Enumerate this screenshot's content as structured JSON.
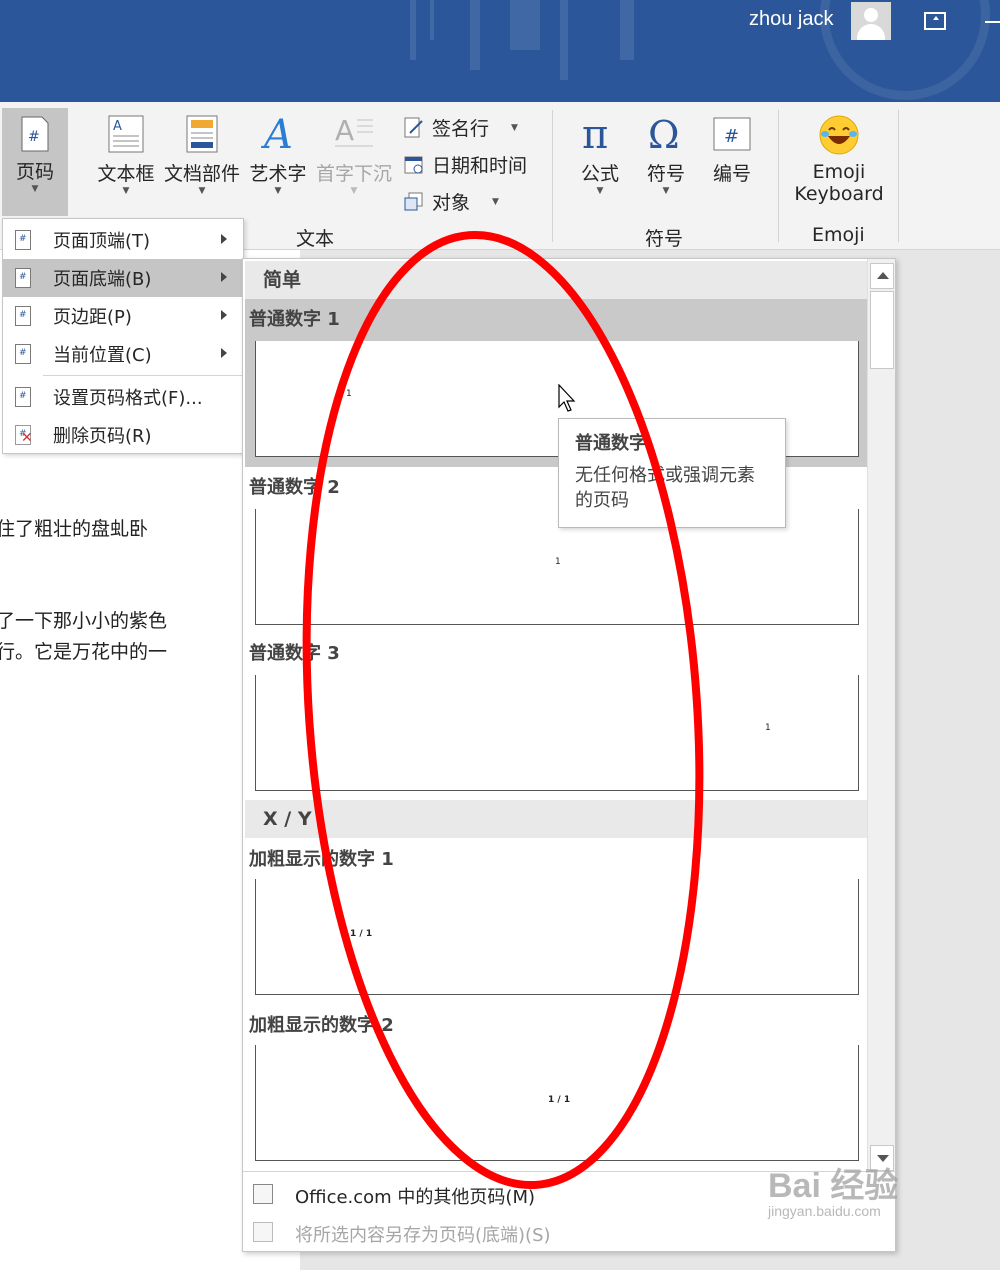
{
  "titlebar": {
    "user_name": "zhou jack",
    "accent": "#2b579a"
  },
  "ribbon": {
    "page_number": "页码",
    "textbox": "文本框",
    "quick_parts": "文档部件",
    "wordart": "艺术字",
    "dropcap": "首字下沉",
    "signature_line": "签名行",
    "date_time": "日期和时间",
    "object": "对象",
    "text_group": "文本",
    "equation": "公式",
    "symbol": "符号",
    "number": "编号",
    "symbols_group": "符号",
    "emoji_label_1": "Emoji",
    "emoji_label_2": "Keyboard",
    "emoji_group": "Emoji"
  },
  "menu": {
    "items": [
      {
        "label": "页面顶端(T)"
      },
      {
        "label": "页面底端(B)"
      },
      {
        "label": "页边距(P)"
      },
      {
        "label": "当前位置(C)"
      },
      {
        "label": "设置页码格式(F)..."
      },
      {
        "label": "删除页码(R)"
      }
    ]
  },
  "gallery": {
    "section_simple": "简单",
    "section_xy": "X / Y",
    "items": [
      {
        "title": "普通数字 1",
        "sample": "1"
      },
      {
        "title": "普通数字 2",
        "sample": "1"
      },
      {
        "title": "普通数字 3",
        "sample": "1"
      },
      {
        "title": "加粗显示的数字 1",
        "sample": "1 / 1"
      },
      {
        "title": "加粗显示的数字 2",
        "sample": "1 / 1"
      }
    ],
    "footer_more": "Office.com 中的其他页码(M)",
    "footer_save": "将所选内容另存为页码(底端)(S)"
  },
  "tooltip": {
    "title": "普通数字",
    "desc_line1": "无任何格式或强调元素",
    "desc_line2": "的页码"
  },
  "document": {
    "line1": "住了粗壮的盘虬卧",
    "line2": "了一下那小小的紫色",
    "line3": "行。它是万花中的一"
  },
  "watermark": {
    "brand": "Bai  经验",
    "url": "jingyan.baidu.com"
  },
  "annotation_color": "#ff0000"
}
